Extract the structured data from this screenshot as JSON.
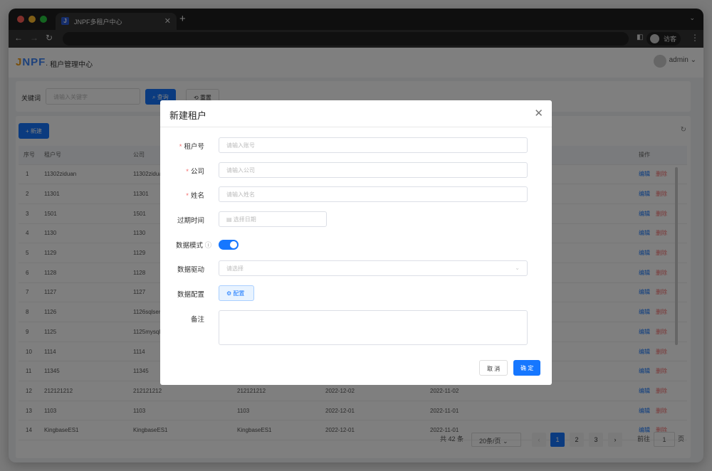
{
  "browser": {
    "tab_title": "JNPF多租户中心",
    "tab_favicon": "J",
    "guest_label": "访客"
  },
  "header": {
    "logo": "JNPF",
    "title": "· 租户管理中心",
    "user": "admin"
  },
  "search": {
    "label": "关键词",
    "placeholder": "请输入关键字",
    "query_label": "查询",
    "reset_label": "重置"
  },
  "toolbar": {
    "new_label": "新建"
  },
  "table": {
    "columns": [
      "序号",
      "租户号",
      "公司",
      "",
      "",
      "",
      "",
      "操作"
    ],
    "rows": [
      [
        "1",
        "11302ziduan",
        "11302ziduan",
        "",
        "",
        "",
        ""
      ],
      [
        "2",
        "11301",
        "11301",
        "",
        "",
        "",
        ""
      ],
      [
        "3",
        "1501",
        "1501",
        "",
        "",
        "",
        ""
      ],
      [
        "4",
        "1130",
        "1130",
        "",
        "",
        "",
        ""
      ],
      [
        "5",
        "1129",
        "1129",
        "",
        "",
        "",
        ""
      ],
      [
        "6",
        "1128",
        "1128",
        "",
        "",
        "",
        ""
      ],
      [
        "7",
        "1127",
        "1127",
        "",
        "",
        "",
        ""
      ],
      [
        "8",
        "1126",
        "1126sqlserver",
        "",
        "",
        "",
        ""
      ],
      [
        "9",
        "1125",
        "1125mysql",
        "",
        "",
        "",
        ""
      ],
      [
        "10",
        "1114",
        "1114",
        "",
        "",
        "",
        ""
      ],
      [
        "11",
        "11345",
        "11345",
        "",
        "",
        "",
        ""
      ],
      [
        "12",
        "212121212",
        "212121212",
        "212121212",
        "2022-12-02",
        "2022-11-02",
        ""
      ],
      [
        "13",
        "1103",
        "1103",
        "1103",
        "2022-12-01",
        "2022-11-01",
        ""
      ],
      [
        "14",
        "KingbaseES1",
        "KingbaseES1",
        "KingbaseES1",
        "2022-12-01",
        "2022-11-01",
        ""
      ]
    ],
    "edit_label": "编辑",
    "delete_label": "删除"
  },
  "pagination": {
    "total": "共 42 条",
    "page_size": "20条/页",
    "pages": [
      "1",
      "2",
      "3"
    ],
    "current": 1,
    "goto_label": "前往",
    "goto_value": "1",
    "page_suffix": "页"
  },
  "modal": {
    "title": "新建租户",
    "fields": [
      {
        "label": "租户号",
        "required": true,
        "placeholder": "请输入账号"
      },
      {
        "label": "公司",
        "required": true,
        "placeholder": "请输入公司"
      },
      {
        "label": "姓名",
        "required": true,
        "placeholder": "请输入姓名"
      },
      {
        "label": "过期时间",
        "placeholder": "选择日期"
      },
      {
        "label": "数据模式",
        "toggle_on": true
      },
      {
        "label": "数据驱动",
        "placeholder": "请选择"
      },
      {
        "label": "数据配置",
        "button": "配置"
      },
      {
        "label": "备注"
      }
    ],
    "cancel_label": "取 消",
    "ok_label": "确 定"
  },
  "colors": {
    "primary": "#1677ff",
    "danger": "#f56c6c"
  }
}
